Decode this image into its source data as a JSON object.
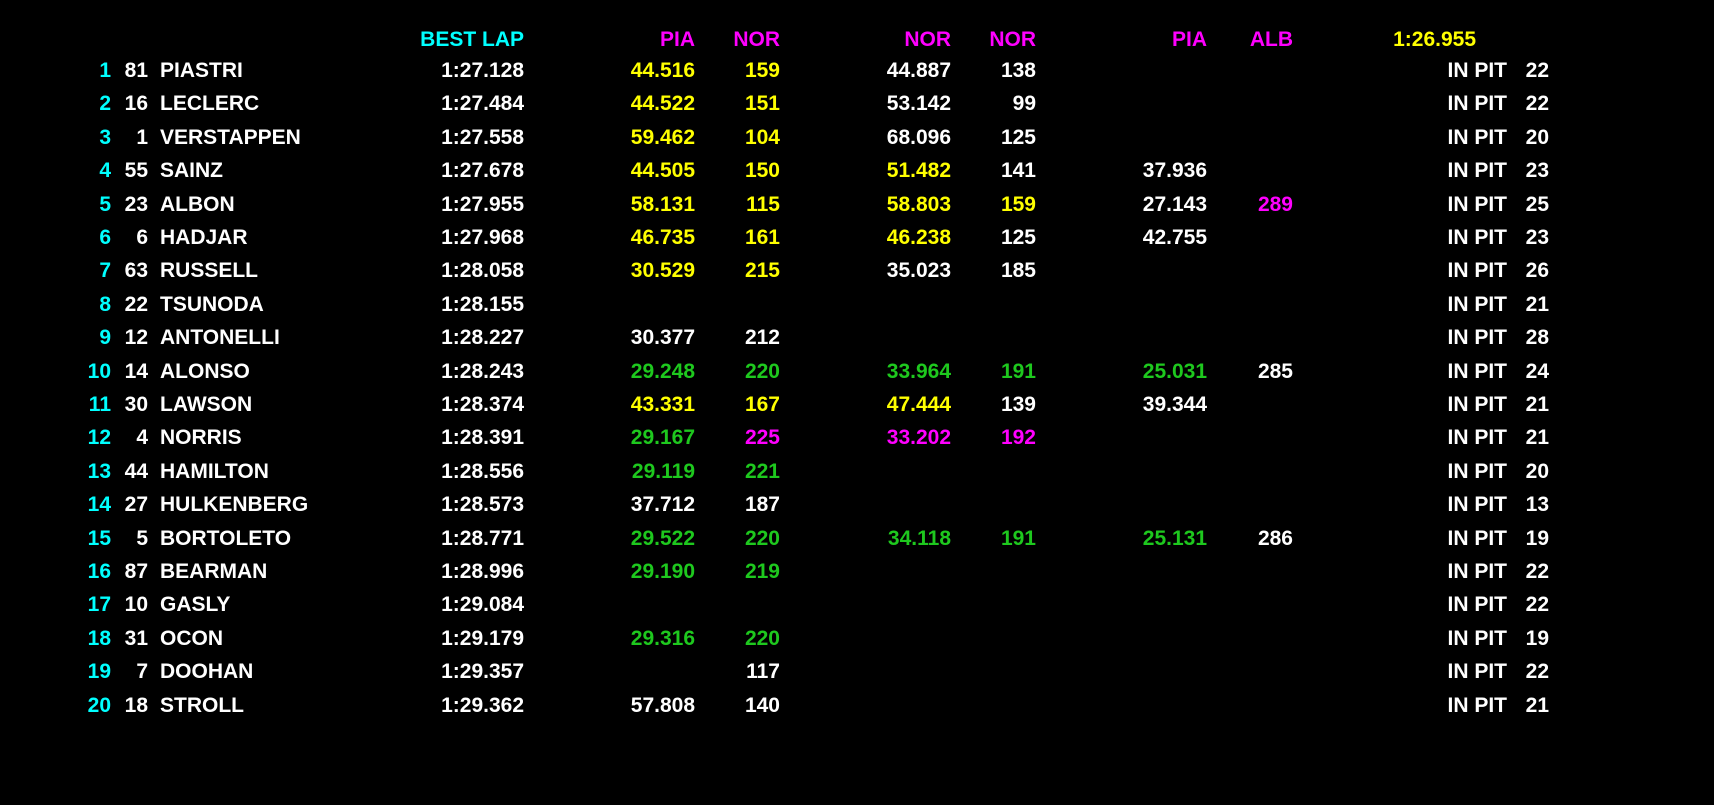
{
  "colors": {
    "white": "#ffffff",
    "yellow": "#ffff00",
    "green": "#1ec81e",
    "magenta": "#ff00ff",
    "cyan": "#00ffff",
    "background": "#000000"
  },
  "header": {
    "best_lap": {
      "text": "BEST LAP",
      "color": "cyan"
    },
    "s1_name": {
      "text": "PIA",
      "color": "magenta"
    },
    "s1_speed": {
      "text": "NOR",
      "color": "magenta"
    },
    "s2_name": {
      "text": "NOR",
      "color": "magenta"
    },
    "s2_speed": {
      "text": "NOR",
      "color": "magenta"
    },
    "s3_name": {
      "text": "PIA",
      "color": "magenta"
    },
    "s3_speed": {
      "text": "ALB",
      "color": "magenta"
    },
    "ideal_lap": {
      "text": "1:26.955",
      "color": "yellow"
    }
  },
  "rows": [
    {
      "pos": "1",
      "num": "81",
      "name": "PIASTRI",
      "best": "1:27.128",
      "s1": "44.516",
      "s1c": "yellow",
      "sp1": "159",
      "sp1c": "yellow",
      "s2": "44.887",
      "s2c": "white",
      "sp2": "138",
      "sp2c": "white",
      "s3": "",
      "s3c": "white",
      "sp3": "",
      "sp3c": "white",
      "status": "IN PIT",
      "laps": "22"
    },
    {
      "pos": "2",
      "num": "16",
      "name": "LECLERC",
      "best": "1:27.484",
      "s1": "44.522",
      "s1c": "yellow",
      "sp1": "151",
      "sp1c": "yellow",
      "s2": "53.142",
      "s2c": "white",
      "sp2": "99",
      "sp2c": "white",
      "s3": "",
      "s3c": "white",
      "sp3": "",
      "sp3c": "white",
      "status": "IN PIT",
      "laps": "22"
    },
    {
      "pos": "3",
      "num": "1",
      "name": "VERSTAPPEN",
      "best": "1:27.558",
      "s1": "59.462",
      "s1c": "yellow",
      "sp1": "104",
      "sp1c": "yellow",
      "s2": "68.096",
      "s2c": "white",
      "sp2": "125",
      "sp2c": "white",
      "s3": "",
      "s3c": "white",
      "sp3": "",
      "sp3c": "white",
      "status": "IN PIT",
      "laps": "20"
    },
    {
      "pos": "4",
      "num": "55",
      "name": "SAINZ",
      "best": "1:27.678",
      "s1": "44.505",
      "s1c": "yellow",
      "sp1": "150",
      "sp1c": "yellow",
      "s2": "51.482",
      "s2c": "yellow",
      "sp2": "141",
      "sp2c": "white",
      "s3": "37.936",
      "s3c": "white",
      "sp3": "",
      "sp3c": "white",
      "status": "IN PIT",
      "laps": "23"
    },
    {
      "pos": "5",
      "num": "23",
      "name": "ALBON",
      "best": "1:27.955",
      "s1": "58.131",
      "s1c": "yellow",
      "sp1": "115",
      "sp1c": "yellow",
      "s2": "58.803",
      "s2c": "yellow",
      "sp2": "159",
      "sp2c": "yellow",
      "s3": "27.143",
      "s3c": "white",
      "sp3": "289",
      "sp3c": "magenta",
      "status": "IN PIT",
      "laps": "25"
    },
    {
      "pos": "6",
      "num": "6",
      "name": "HADJAR",
      "best": "1:27.968",
      "s1": "46.735",
      "s1c": "yellow",
      "sp1": "161",
      "sp1c": "yellow",
      "s2": "46.238",
      "s2c": "yellow",
      "sp2": "125",
      "sp2c": "white",
      "s3": "42.755",
      "s3c": "white",
      "sp3": "",
      "sp3c": "white",
      "status": "IN PIT",
      "laps": "23"
    },
    {
      "pos": "7",
      "num": "63",
      "name": "RUSSELL",
      "best": "1:28.058",
      "s1": "30.529",
      "s1c": "yellow",
      "sp1": "215",
      "sp1c": "yellow",
      "s2": "35.023",
      "s2c": "white",
      "sp2": "185",
      "sp2c": "white",
      "s3": "",
      "s3c": "white",
      "sp3": "",
      "sp3c": "white",
      "status": "IN PIT",
      "laps": "26"
    },
    {
      "pos": "8",
      "num": "22",
      "name": "TSUNODA",
      "best": "1:28.155",
      "s1": "",
      "s1c": "white",
      "sp1": "",
      "sp1c": "white",
      "s2": "",
      "s2c": "white",
      "sp2": "",
      "sp2c": "white",
      "s3": "",
      "s3c": "white",
      "sp3": "",
      "sp3c": "white",
      "status": "IN PIT",
      "laps": "21"
    },
    {
      "pos": "9",
      "num": "12",
      "name": "ANTONELLI",
      "best": "1:28.227",
      "s1": "30.377",
      "s1c": "white",
      "sp1": "212",
      "sp1c": "white",
      "s2": "",
      "s2c": "white",
      "sp2": "",
      "sp2c": "white",
      "s3": "",
      "s3c": "white",
      "sp3": "",
      "sp3c": "white",
      "status": "IN PIT",
      "laps": "28"
    },
    {
      "pos": "10",
      "num": "14",
      "name": "ALONSO",
      "best": "1:28.243",
      "s1": "29.248",
      "s1c": "green",
      "sp1": "220",
      "sp1c": "green",
      "s2": "33.964",
      "s2c": "green",
      "sp2": "191",
      "sp2c": "green",
      "s3": "25.031",
      "s3c": "green",
      "sp3": "285",
      "sp3c": "white",
      "status": "IN PIT",
      "laps": "24"
    },
    {
      "pos": "11",
      "num": "30",
      "name": "LAWSON",
      "best": "1:28.374",
      "s1": "43.331",
      "s1c": "yellow",
      "sp1": "167",
      "sp1c": "yellow",
      "s2": "47.444",
      "s2c": "yellow",
      "sp2": "139",
      "sp2c": "white",
      "s3": "39.344",
      "s3c": "white",
      "sp3": "",
      "sp3c": "white",
      "status": "IN PIT",
      "laps": "21"
    },
    {
      "pos": "12",
      "num": "4",
      "name": "NORRIS",
      "best": "1:28.391",
      "s1": "29.167",
      "s1c": "green",
      "sp1": "225",
      "sp1c": "magenta",
      "s2": "33.202",
      "s2c": "magenta",
      "sp2": "192",
      "sp2c": "magenta",
      "s3": "",
      "s3c": "white",
      "sp3": "",
      "sp3c": "white",
      "status": "IN PIT",
      "laps": "21"
    },
    {
      "pos": "13",
      "num": "44",
      "name": "HAMILTON",
      "best": "1:28.556",
      "s1": "29.119",
      "s1c": "green",
      "sp1": "221",
      "sp1c": "green",
      "s2": "",
      "s2c": "white",
      "sp2": "",
      "sp2c": "white",
      "s3": "",
      "s3c": "white",
      "sp3": "",
      "sp3c": "white",
      "status": "IN PIT",
      "laps": "20"
    },
    {
      "pos": "14",
      "num": "27",
      "name": "HULKENBERG",
      "best": "1:28.573",
      "s1": "37.712",
      "s1c": "white",
      "sp1": "187",
      "sp1c": "white",
      "s2": "",
      "s2c": "white",
      "sp2": "",
      "sp2c": "white",
      "s3": "",
      "s3c": "white",
      "sp3": "",
      "sp3c": "white",
      "status": "IN PIT",
      "laps": "13"
    },
    {
      "pos": "15",
      "num": "5",
      "name": "BORTOLETO",
      "best": "1:28.771",
      "s1": "29.522",
      "s1c": "green",
      "sp1": "220",
      "sp1c": "green",
      "s2": "34.118",
      "s2c": "green",
      "sp2": "191",
      "sp2c": "green",
      "s3": "25.131",
      "s3c": "green",
      "sp3": "286",
      "sp3c": "white",
      "status": "IN PIT",
      "laps": "19"
    },
    {
      "pos": "16",
      "num": "87",
      "name": "BEARMAN",
      "best": "1:28.996",
      "s1": "29.190",
      "s1c": "green",
      "sp1": "219",
      "sp1c": "green",
      "s2": "",
      "s2c": "white",
      "sp2": "",
      "sp2c": "white",
      "s3": "",
      "s3c": "white",
      "sp3": "",
      "sp3c": "white",
      "status": "IN PIT",
      "laps": "22"
    },
    {
      "pos": "17",
      "num": "10",
      "name": "GASLY",
      "best": "1:29.084",
      "s1": "",
      "s1c": "white",
      "sp1": "",
      "sp1c": "white",
      "s2": "",
      "s2c": "white",
      "sp2": "",
      "sp2c": "white",
      "s3": "",
      "s3c": "white",
      "sp3": "",
      "sp3c": "white",
      "status": "IN PIT",
      "laps": "22"
    },
    {
      "pos": "18",
      "num": "31",
      "name": "OCON",
      "best": "1:29.179",
      "s1": "29.316",
      "s1c": "green",
      "sp1": "220",
      "sp1c": "green",
      "s2": "",
      "s2c": "white",
      "sp2": "",
      "sp2c": "white",
      "s3": "",
      "s3c": "white",
      "sp3": "",
      "sp3c": "white",
      "status": "IN PIT",
      "laps": "19"
    },
    {
      "pos": "19",
      "num": "7",
      "name": "DOOHAN",
      "best": "1:29.357",
      "s1": "",
      "s1c": "white",
      "sp1": "117",
      "sp1c": "white",
      "s2": "",
      "s2c": "white",
      "sp2": "",
      "sp2c": "white",
      "s3": "",
      "s3c": "white",
      "sp3": "",
      "sp3c": "white",
      "status": "IN PIT",
      "laps": "22"
    },
    {
      "pos": "20",
      "num": "18",
      "name": "STROLL",
      "best": "1:29.362",
      "s1": "57.808",
      "s1c": "white",
      "sp1": "140",
      "sp1c": "white",
      "s2": "",
      "s2c": "white",
      "sp2": "",
      "sp2c": "white",
      "s3": "",
      "s3c": "white",
      "sp3": "",
      "sp3c": "white",
      "status": "IN PIT",
      "laps": "21"
    }
  ]
}
